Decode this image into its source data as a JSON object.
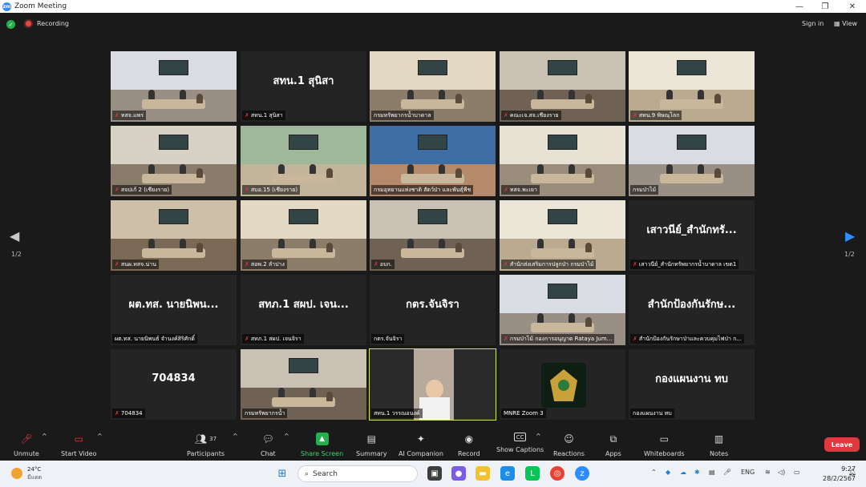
{
  "window": {
    "title": "Zoom Meeting",
    "minimize": "—",
    "restore": "❐",
    "close": "✕"
  },
  "topbar": {
    "recording": "Recording",
    "sign_in": "Sign in",
    "view": "View"
  },
  "pager": {
    "left": "1/2",
    "right": "1/2"
  },
  "tiles": [
    {
      "kind": "video",
      "label": "ทสจ.แพร่",
      "muted": true
    },
    {
      "kind": "name",
      "display": "สทน.1 สุนิสา",
      "label": "สทน.1 สุนิสา",
      "muted": true
    },
    {
      "kind": "video",
      "label": "กรมทรัพยากรน้ำบาดาล",
      "muted": false
    },
    {
      "kind": "video",
      "label": "คณะเจ.สจ.เชียงราย",
      "muted": true
    },
    {
      "kind": "video",
      "label": "สทน.9 พิษณุโลก",
      "muted": true
    },
    {
      "kind": "video",
      "label": "สจปเก้ 2 (เชียงราย)",
      "muted": true
    },
    {
      "kind": "video",
      "label": "สบอ.15 (เชียงราย)",
      "muted": true
    },
    {
      "kind": "video",
      "label": "กรมอุทยานแห่งชาติ สัตว์ป่า และพันธุ์พืช",
      "muted": false
    },
    {
      "kind": "video",
      "label": "ทสจ.พะเยา",
      "muted": true
    },
    {
      "kind": "video",
      "label": "กรมป่าไม้",
      "muted": false
    },
    {
      "kind": "video",
      "label": "สนผ.ทสจ.น่าน",
      "muted": true
    },
    {
      "kind": "video",
      "label": "สอพ.2 ลำปาง",
      "muted": true
    },
    {
      "kind": "video",
      "label": "อบก.",
      "muted": true
    },
    {
      "kind": "video",
      "label": "สำนักส่งเสริมการปลูกป่า กรมป่าไม้",
      "muted": true
    },
    {
      "kind": "name",
      "display": "เสาวนีย์_สำนักทรั...",
      "label": "เสาวนีย์_สำนักทรัพยากรน้ำบาดาล เขต1",
      "muted": true
    },
    {
      "kind": "name",
      "display": "ผต.ทส. นายนิพน...",
      "label": "ผต.ทส. นายนิพนธ์ จำนงค์สิริศักดิ์",
      "muted": false
    },
    {
      "kind": "name",
      "display": "สทภ.1 สผป. เจน...",
      "label": "สทภ.1 สผป. เจนจิรา",
      "muted": true
    },
    {
      "kind": "name",
      "display": "กตร.จันจิรา",
      "label": "กตร.จันจิรา",
      "muted": false
    },
    {
      "kind": "video",
      "label": "กรมป่าไม้ กองการอนุญาต Rataya Jum...",
      "muted": true
    },
    {
      "kind": "name",
      "display": "สำนักป้องกันรักษ...",
      "label": "สำนักป้องกันรักษาป่าและควบคุมไฟป่า ก...",
      "muted": true
    },
    {
      "kind": "name",
      "display": "704834",
      "label": "704834",
      "muted": true
    },
    {
      "kind": "video",
      "label": "กรมทรัพยากรน้ำ",
      "muted": false
    },
    {
      "kind": "video",
      "label": "สทน.1 วรรณอนงค์",
      "muted": false,
      "active": true
    },
    {
      "kind": "logo",
      "label": "MNRE Zoom 3",
      "muted": false
    },
    {
      "kind": "name",
      "display": "กองแผนงาน ทบ",
      "label": "กองแผนงาน ทบ",
      "muted": false
    }
  ],
  "toolbar": {
    "unmute": "Unmute",
    "start_video": "Start Video",
    "participants": "Participants",
    "participants_count": "37",
    "chat": "Chat",
    "share": "Share Screen",
    "summary": "Summary",
    "ai": "AI Companion",
    "record": "Record",
    "captions": "Show Captions",
    "reactions": "Reactions",
    "apps": "Apps",
    "whiteboards": "Whiteboards",
    "notes": "Notes",
    "leave": "Leave"
  },
  "taskbar": {
    "temp": "24°C",
    "weather": "มีแดด",
    "search": "Search",
    "lang": "ENG",
    "time": "9:27",
    "date": "28/2/2567"
  }
}
